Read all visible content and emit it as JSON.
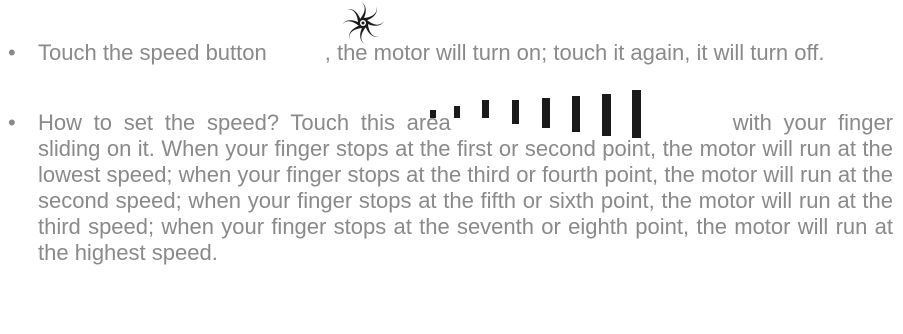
{
  "instructions": {
    "item1": {
      "before_icon": "Touch the speed button",
      "after_icon": ", the motor will turn on; touch it again, it will turn off."
    },
    "item2": {
      "before_icon": "How to set the speed? Touch this area",
      "after_icon": "with your finger sliding on it. When your finger stops at the first or second point, the motor will run at the lowest speed; when your finger stops at the third or fourth point, the motor will run at the second speed; when your finger stops at the fifth or sixth point, the motor will run at the third speed; when your finger stops at the seventh or eighth point, the motor will run at the highest speed."
    }
  },
  "icons": {
    "speed_button": "fan-icon",
    "speed_slider": "speed-bars-icon"
  },
  "colors": {
    "text": "#8a8a8a",
    "icon": "#1a1a1a"
  }
}
